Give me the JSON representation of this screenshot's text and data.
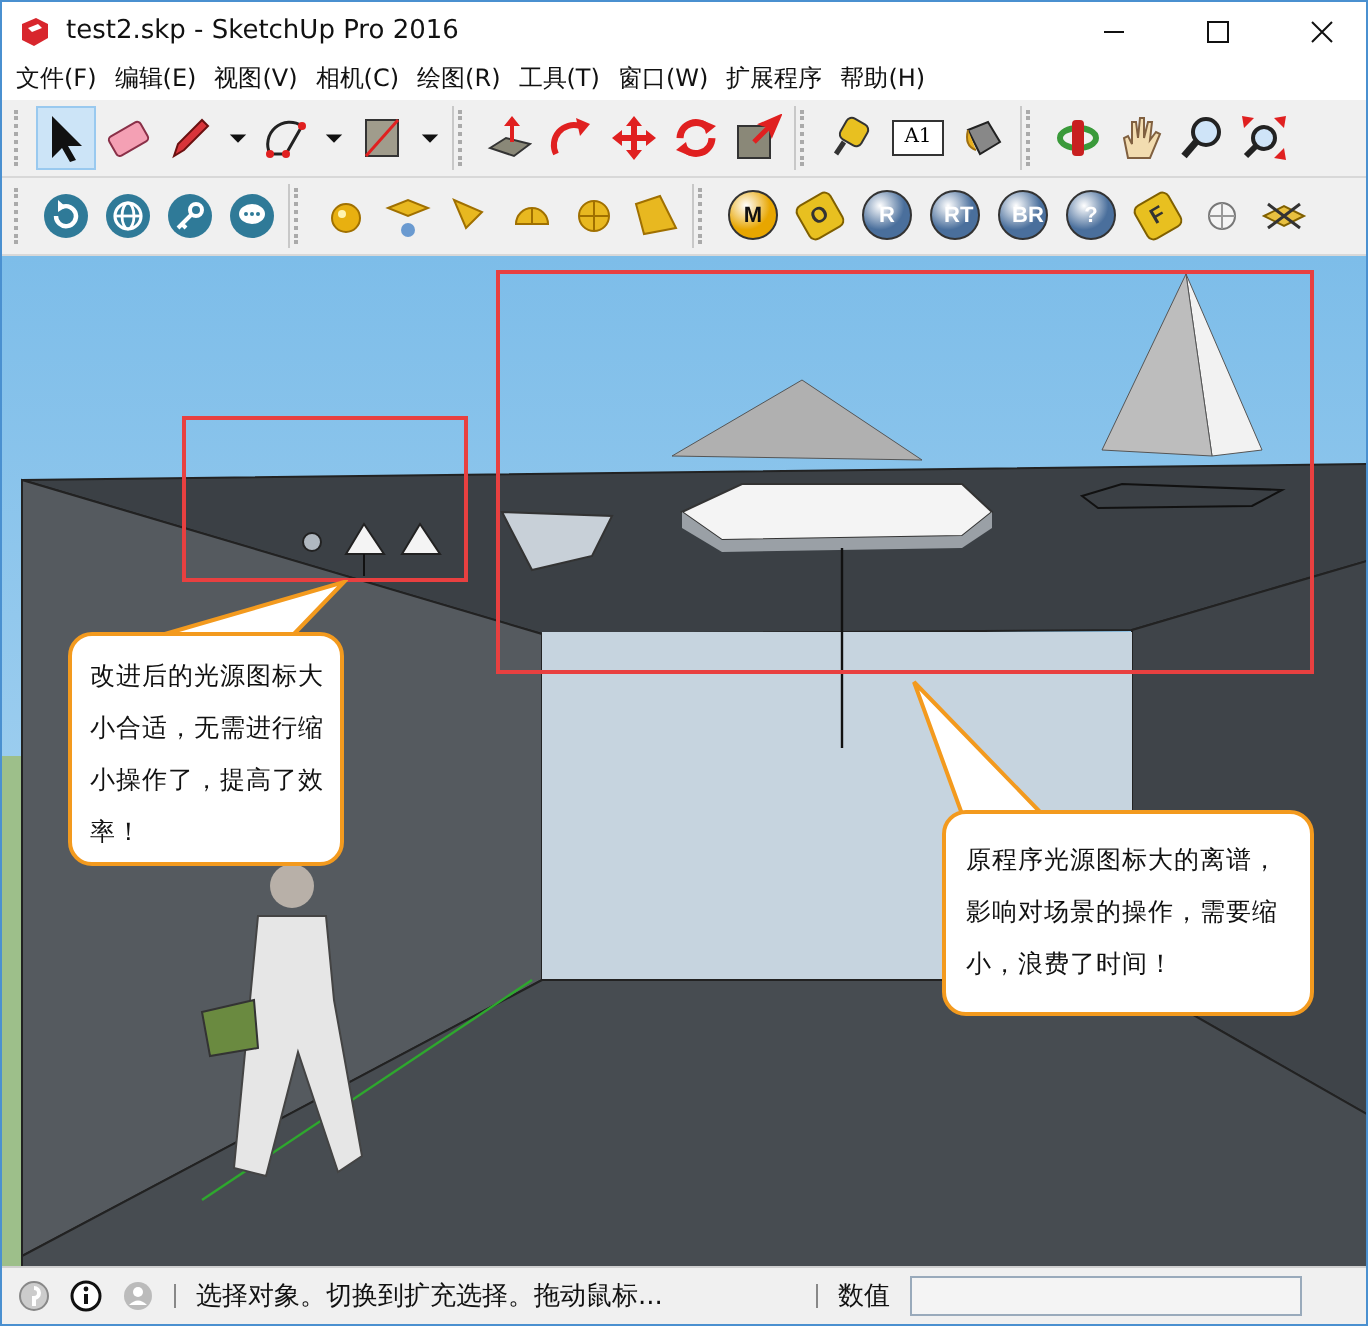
{
  "window": {
    "title": "test2.skp - SketchUp Pro 2016"
  },
  "menu": [
    "文件(F)",
    "编辑(E)",
    "视图(V)",
    "相机(C)",
    "绘图(R)",
    "工具(T)",
    "窗口(W)",
    "扩展程序",
    "帮助(H)"
  ],
  "toolbars": [
    {
      "groups": [
        [
          {
            "kind": "select",
            "selected": true
          },
          {
            "kind": "eraser",
            "selected": false
          },
          {
            "kind": "pencil",
            "selected": false
          },
          {
            "kind": "dropdown",
            "selected": false
          },
          {
            "kind": "arc",
            "selected": false
          },
          {
            "kind": "dropdown",
            "selected": false
          },
          {
            "kind": "rectangle",
            "selected": false
          },
          {
            "kind": "dropdown",
            "selected": false
          }
        ],
        [
          {
            "kind": "pushpull",
            "selected": false
          },
          {
            "kind": "followme",
            "selected": false
          },
          {
            "kind": "move",
            "selected": false
          },
          {
            "kind": "rotate",
            "selected": false
          },
          {
            "kind": "scale",
            "selected": false
          }
        ],
        [
          {
            "kind": "tape",
            "selected": false
          },
          {
            "kind": "text",
            "label": "A1",
            "selected": false
          },
          {
            "kind": "paint",
            "selected": false
          }
        ],
        [
          {
            "kind": "orbit",
            "selected": false
          },
          {
            "kind": "pan",
            "selected": false
          },
          {
            "kind": "zoom",
            "selected": false
          },
          {
            "kind": "zoomext",
            "selected": false
          }
        ]
      ]
    },
    {
      "groups": [
        [
          {
            "kind": "refresh",
            "selected": false
          },
          {
            "kind": "globe",
            "selected": false
          },
          {
            "kind": "key",
            "selected": false
          },
          {
            "kind": "chat",
            "selected": false
          }
        ],
        [
          {
            "kind": "sphere",
            "selected": false
          },
          {
            "kind": "planelight",
            "selected": false
          },
          {
            "kind": "cone",
            "selected": false
          },
          {
            "kind": "dome",
            "selected": false
          },
          {
            "kind": "gridsphere",
            "selected": false
          },
          {
            "kind": "lamp",
            "selected": false
          }
        ],
        [
          {
            "kind": "ball",
            "label": "M",
            "color": "#e8a600",
            "selected": false
          },
          {
            "kind": "tag",
            "label": "O",
            "selected": false
          },
          {
            "kind": "ball",
            "label": "R",
            "color": "#4a6f9c",
            "selected": false
          },
          {
            "kind": "ball",
            "label": "RT",
            "color": "#4a6f9c",
            "selected": false
          },
          {
            "kind": "ball",
            "label": "BR",
            "color": "#4a6f9c",
            "selected": false
          },
          {
            "kind": "ball",
            "label": "?",
            "color": "#4a6f9c",
            "selected": false
          },
          {
            "kind": "tag",
            "label": "F",
            "selected": false
          },
          {
            "kind": "whitesphere",
            "selected": false
          },
          {
            "kind": "crossplane",
            "selected": false
          }
        ]
      ]
    }
  ],
  "callouts": [
    {
      "text": "改进后的光源图标大小合适，无需进行缩小操作了，提高了效率！"
    },
    {
      "text": "原程序光源图标大的离谱，影响对场景的操作，需要缩小，浪费了时间！"
    }
  ],
  "status_bar": {
    "message": "选择对象。切换到扩充选择。拖动鼠标...",
    "measurements_label": "数值"
  }
}
